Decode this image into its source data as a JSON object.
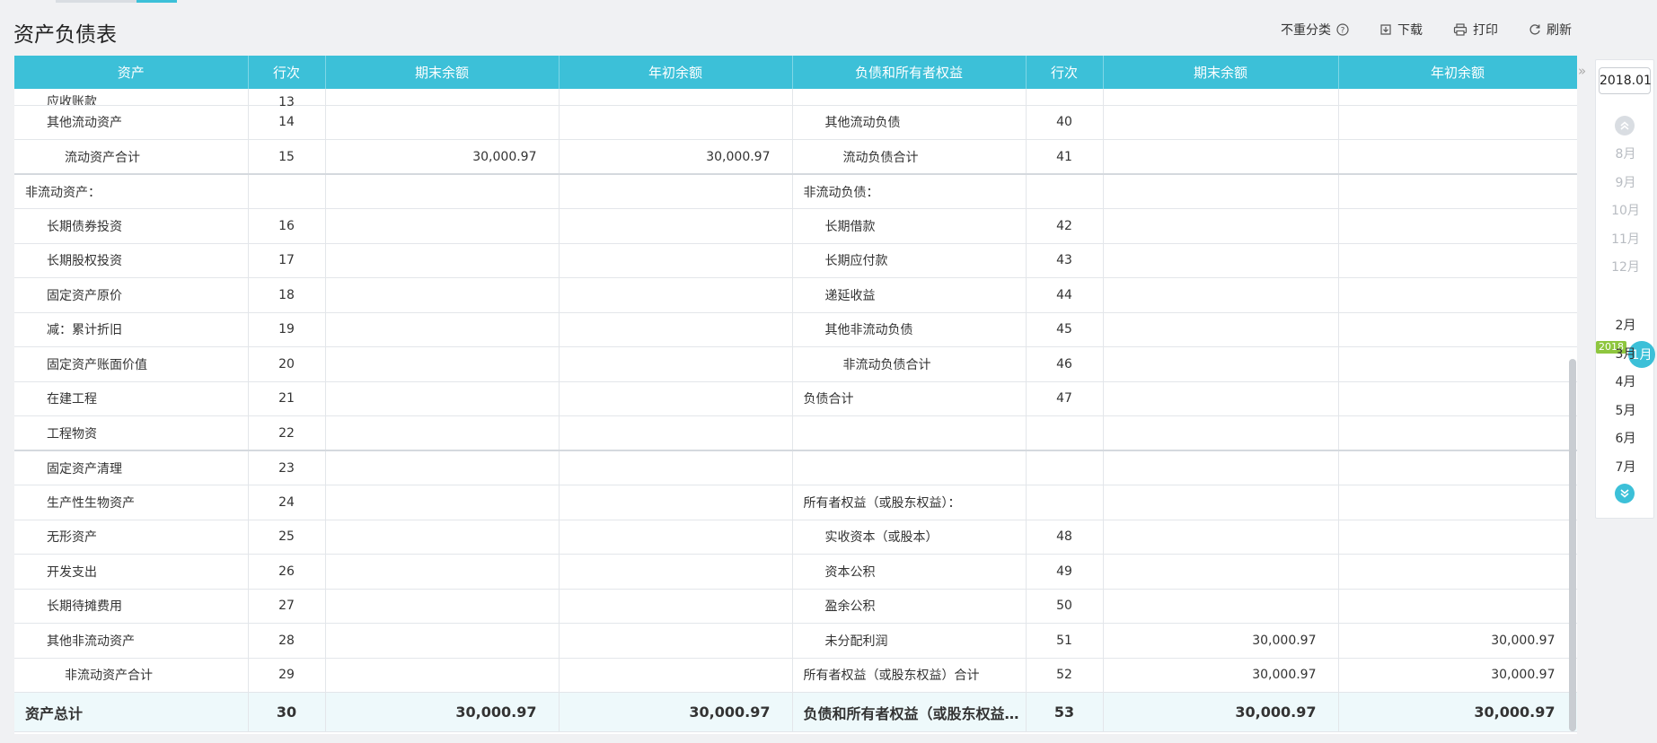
{
  "page": {
    "title": "资产负债表"
  },
  "toolbar": {
    "reclass_label": "不重分类",
    "download_label": "下载",
    "print_label": "打印",
    "refresh_label": "刷新"
  },
  "table": {
    "headers": [
      "资产",
      "行次",
      "期末余额",
      "年初余额",
      "负债和所有者权益",
      "行次",
      "期末余额",
      "年初余额"
    ],
    "partial_row": {
      "left_name": "应收账款",
      "left_no": "13"
    },
    "rows": [
      {
        "ln": "其他流动资产",
        "li": 1,
        "lno": "14",
        "le": "",
        "ls": "",
        "rn": "其他流动负债",
        "ri": 1,
        "rno": "40",
        "re": "",
        "rs": ""
      },
      {
        "ln": "流动资产合计",
        "li": 2,
        "lno": "15",
        "le": "30,000.97",
        "ls": "30,000.97",
        "rn": "流动负债合计",
        "ri": 2,
        "rno": "41",
        "re": "",
        "rs": ""
      },
      {
        "ln": "非流动资产：",
        "li": 0,
        "lno": "",
        "le": "",
        "ls": "",
        "rn": "非流动负债：",
        "ri": 0,
        "rno": "",
        "re": "",
        "rs": "",
        "sep": true
      },
      {
        "ln": "长期债券投资",
        "li": 1,
        "lno": "16",
        "le": "",
        "ls": "",
        "rn": "长期借款",
        "ri": 1,
        "rno": "42",
        "re": "",
        "rs": ""
      },
      {
        "ln": "长期股权投资",
        "li": 1,
        "lno": "17",
        "le": "",
        "ls": "",
        "rn": "长期应付款",
        "ri": 1,
        "rno": "43",
        "re": "",
        "rs": ""
      },
      {
        "ln": "固定资产原价",
        "li": 1,
        "lno": "18",
        "le": "",
        "ls": "",
        "rn": "递延收益",
        "ri": 1,
        "rno": "44",
        "re": "",
        "rs": ""
      },
      {
        "ln": "减：累计折旧",
        "li": 1,
        "lno": "19",
        "le": "",
        "ls": "",
        "rn": "其他非流动负债",
        "ri": 1,
        "rno": "45",
        "re": "",
        "rs": ""
      },
      {
        "ln": "固定资产账面价值",
        "li": 1,
        "lno": "20",
        "le": "",
        "ls": "",
        "rn": "非流动负债合计",
        "ri": 2,
        "rno": "46",
        "re": "",
        "rs": ""
      },
      {
        "ln": "在建工程",
        "li": 1,
        "lno": "21",
        "le": "",
        "ls": "",
        "rn": "负债合计",
        "ri": 0,
        "rno": "47",
        "re": "",
        "rs": ""
      },
      {
        "ln": "工程物资",
        "li": 1,
        "lno": "22",
        "le": "",
        "ls": "",
        "rn": "",
        "ri": 0,
        "rno": "",
        "re": "",
        "rs": ""
      },
      {
        "ln": "固定资产清理",
        "li": 1,
        "lno": "23",
        "le": "",
        "ls": "",
        "rn": "",
        "ri": 0,
        "rno": "",
        "re": "",
        "rs": "",
        "sep": true
      },
      {
        "ln": "生产性生物资产",
        "li": 1,
        "lno": "24",
        "le": "",
        "ls": "",
        "rn": "所有者权益（或股东权益）：",
        "ri": 0,
        "rno": "",
        "re": "",
        "rs": ""
      },
      {
        "ln": "无形资产",
        "li": 1,
        "lno": "25",
        "le": "",
        "ls": "",
        "rn": "实收资本（或股本）",
        "ri": 1,
        "rno": "48",
        "re": "",
        "rs": ""
      },
      {
        "ln": "开发支出",
        "li": 1,
        "lno": "26",
        "le": "",
        "ls": "",
        "rn": "资本公积",
        "ri": 1,
        "rno": "49",
        "re": "",
        "rs": ""
      },
      {
        "ln": "长期待摊费用",
        "li": 1,
        "lno": "27",
        "le": "",
        "ls": "",
        "rn": "盈余公积",
        "ri": 1,
        "rno": "50",
        "re": "",
        "rs": ""
      },
      {
        "ln": "其他非流动资产",
        "li": 1,
        "lno": "28",
        "le": "",
        "ls": "",
        "rn": "未分配利润",
        "ri": 1,
        "rno": "51",
        "re": "30,000.97",
        "rs": "30,000.97"
      },
      {
        "ln": "非流动资产合计",
        "li": 2,
        "lno": "29",
        "le": "",
        "ls": "",
        "rn": "所有者权益（或股东权益）合计",
        "ri": 0,
        "rno": "52",
        "re": "30,000.97",
        "rs": "30,000.97"
      }
    ],
    "total": {
      "ln": "资产总计",
      "lno": "30",
      "le": "30,000.97",
      "ls": "30,000.97",
      "rn": "负债和所有者权益（或股东权益）总计",
      "rno": "53",
      "re": "30,000.97",
      "rs": "30,000.97"
    }
  },
  "side_panel": {
    "year_value": "2018.01",
    "year_badge": "2018",
    "active_month": "1月",
    "months_before": [
      "8月",
      "9月",
      "10月",
      "11月",
      "12月"
    ],
    "months_after": [
      "2月",
      "3月",
      "4月",
      "5月",
      "6月",
      "7月"
    ]
  },
  "colors": {
    "accent": "#3cc0d8",
    "badge": "#8ec63f"
  }
}
